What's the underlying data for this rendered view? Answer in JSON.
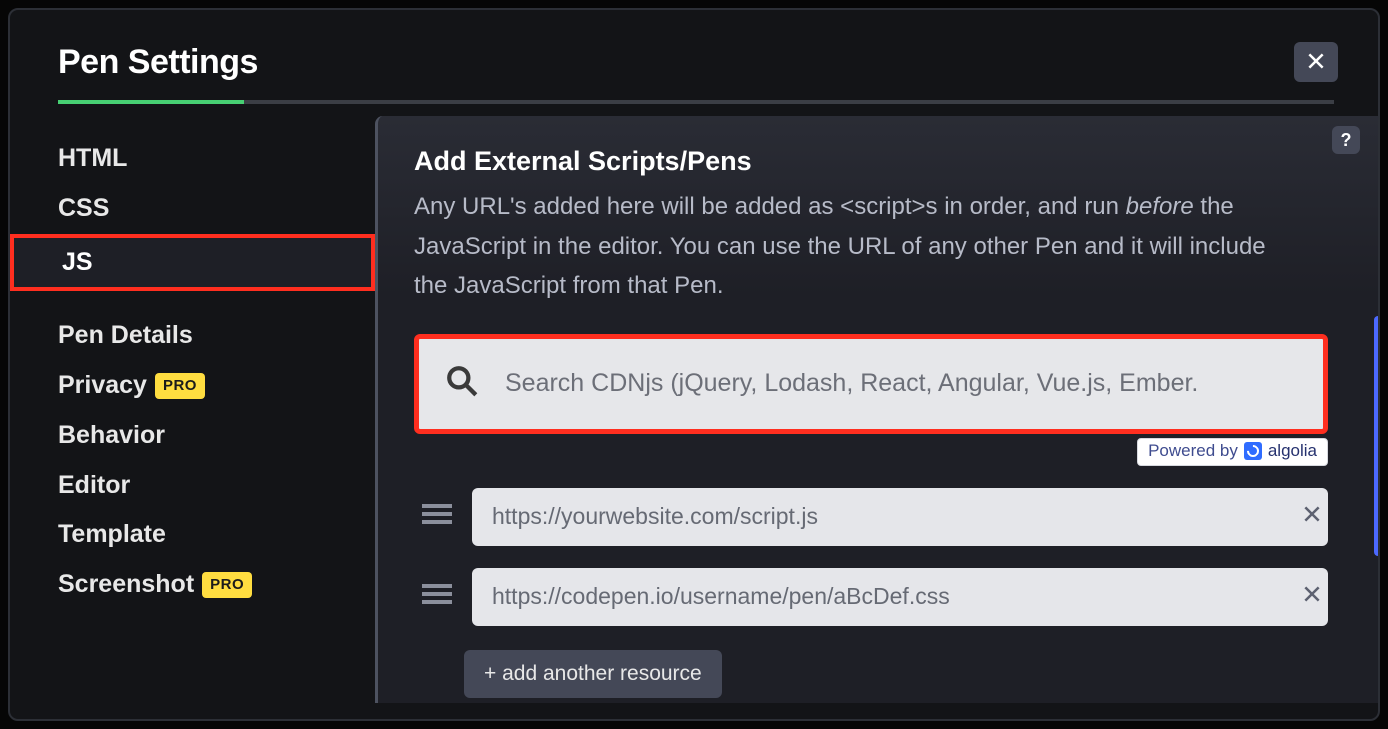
{
  "dialog": {
    "title": "Pen Settings"
  },
  "sidebar": {
    "items": [
      {
        "label": "HTML",
        "active": false,
        "highlight": false,
        "pro": false
      },
      {
        "label": "CSS",
        "active": false,
        "highlight": false,
        "pro": false
      },
      {
        "label": "JS",
        "active": true,
        "highlight": true,
        "pro": false
      }
    ],
    "items2": [
      {
        "label": "Pen Details",
        "pro": false
      },
      {
        "label": "Privacy",
        "pro": true
      },
      {
        "label": "Behavior",
        "pro": false
      },
      {
        "label": "Editor",
        "pro": false
      },
      {
        "label": "Template",
        "pro": false
      },
      {
        "label": "Screenshot",
        "pro": true
      }
    ],
    "pro_label": "PRO"
  },
  "main": {
    "help_label": "?",
    "section_title": "Add External Scripts/Pens",
    "desc_part1": "Any URL's added here will be added as <script>s in order, and run ",
    "desc_em": "before",
    "desc_part2": " the JavaScript in the editor. You can use the URL of any other Pen and it will include the JavaScript from that Pen.",
    "search": {
      "placeholder": "Search CDNjs (jQuery, Lodash, React, Angular, Vue.js, Ember."
    },
    "powered_by_text": "Powered by",
    "algolia_text": "algolia",
    "resources": [
      {
        "placeholder": "https://yourwebsite.com/script.js",
        "value": ""
      },
      {
        "placeholder": "https://codepen.io/username/pen/aBcDef.css",
        "value": ""
      }
    ],
    "add_button_label": "+ add another resource"
  }
}
